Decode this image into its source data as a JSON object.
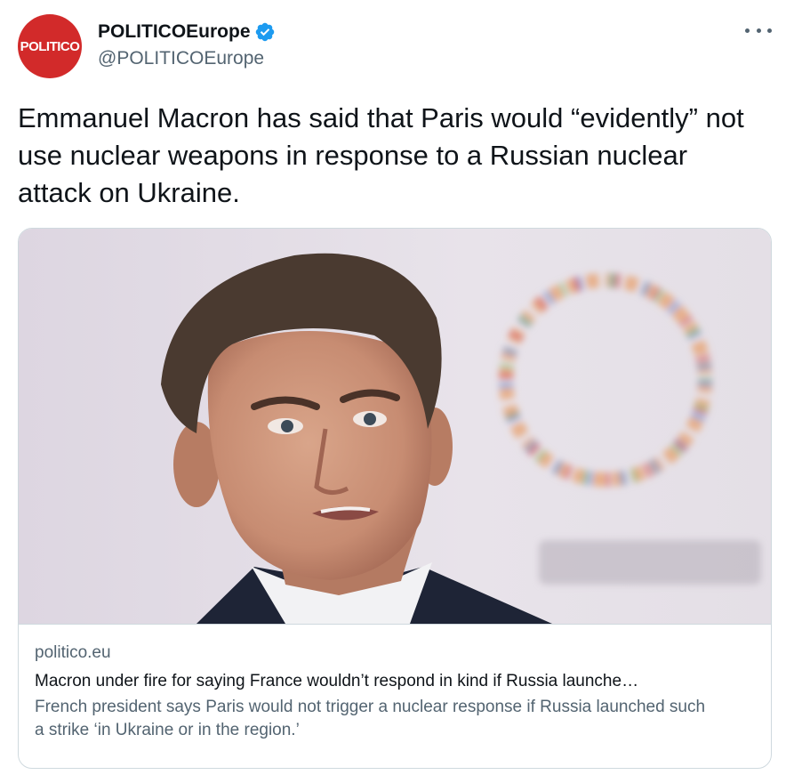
{
  "account": {
    "avatar_text": "POLITICO",
    "display_name": "POLITICOEurope",
    "handle": "@POLITICOEurope",
    "verified": true
  },
  "tweet": {
    "text": "Emmanuel Macron has said that Paris would “evidently” not use nuclear weapons in response to a Russian nuclear attack on Ukraine."
  },
  "card": {
    "domain": "politico.eu",
    "title": "Macron under fire for saying France wouldn’t respond in kind if Russia launche…",
    "description": "French president says Paris would not trigger a nuclear response if Russia launched such a strike ‘in Ukraine or in the region.’"
  },
  "colors": {
    "brand_red": "#d22a2a",
    "verified_blue": "#1d9bf0",
    "text_primary": "#0f1419",
    "text_secondary": "#536471",
    "border": "#cfd9de"
  },
  "icons": {
    "verified": "verified-badge-icon",
    "more": "more-horizontal-icon"
  }
}
